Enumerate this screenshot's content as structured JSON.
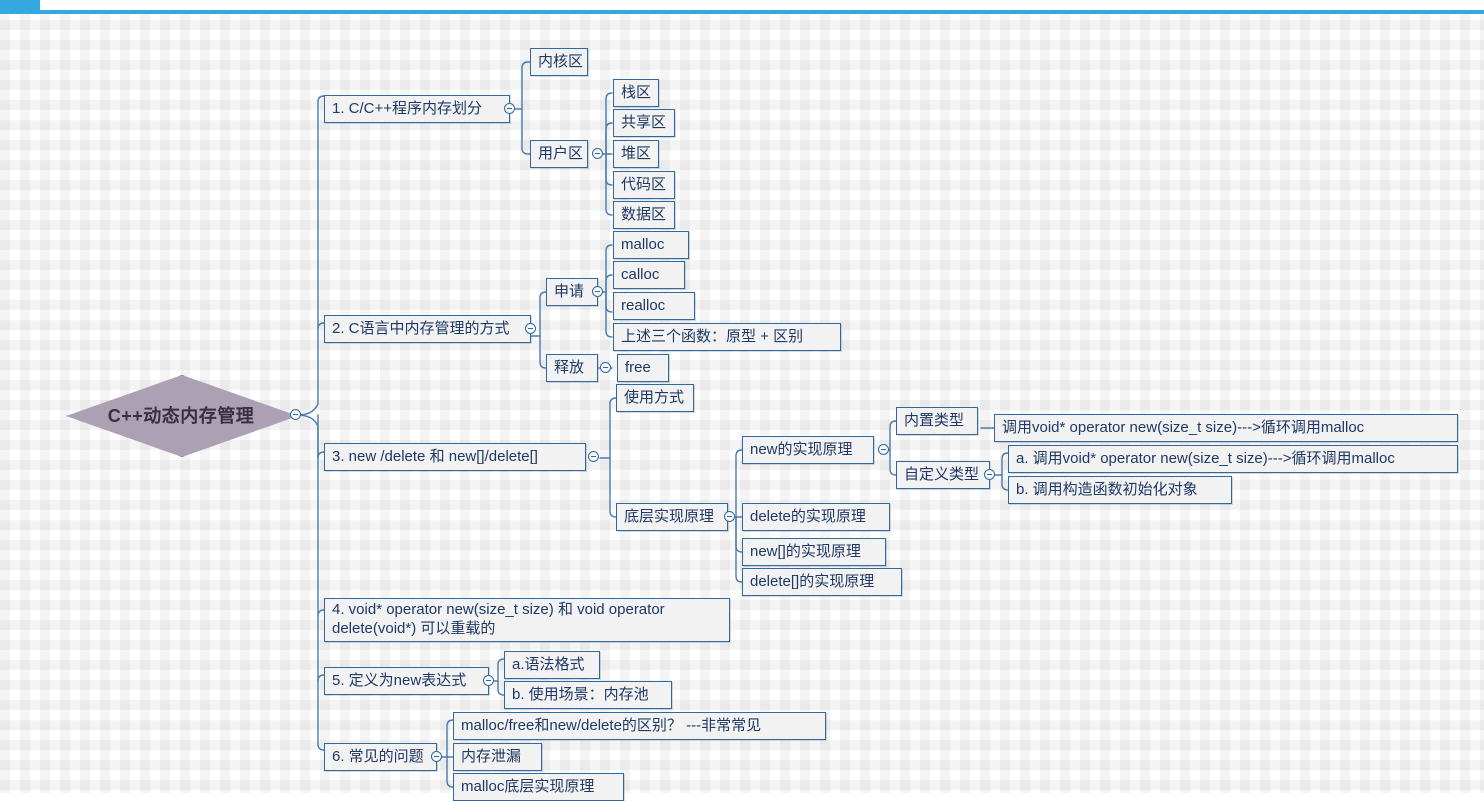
{
  "window": {
    "accent_color": "#35a8dd",
    "tab_label": ""
  },
  "theme": {
    "node_border": "#31699c",
    "node_fill": "#f2f2f2",
    "node_text": "#1f3864",
    "root_fill": "#aca0b4",
    "root_border": "#7d7390",
    "root_text": "#3b2e3f",
    "link_color": "#4a7ab0"
  },
  "diagram": {
    "type": "mindmap",
    "root": "C++动态内存管理",
    "nodes": {
      "root": "C++动态内存管理",
      "b1": "1. C/C++程序内存划分",
      "b1_1": "内核区",
      "b1_2": "用户区",
      "b1_2_1": "栈区",
      "b1_2_2": "共享区",
      "b1_2_3": "堆区",
      "b1_2_4": "代码区",
      "b1_2_5": "数据区",
      "b2": "2. C语言中内存管理的方式",
      "b2_1": "申请",
      "b2_1_1": "malloc",
      "b2_1_2": "calloc",
      "b2_1_3": "realloc",
      "b2_1_4": "上述三个函数：原型 + 区别",
      "b2_2": "释放",
      "b2_2_1": "free",
      "b3": "3. new /delete 和 new[]/delete[]",
      "b3_1": "使用方式",
      "b3_2": "底层实现原理",
      "b3_2_1": "new的实现原理",
      "b3_2_1_1": "内置类型",
      "b3_2_1_1_1": "调用void* operator new(size_t size)--->循环调用malloc",
      "b3_2_1_2": "自定义类型",
      "b3_2_1_2_1": "a. 调用void* operator new(size_t size)--->循环调用malloc",
      "b3_2_1_2_2": "b. 调用构造函数初始化对象",
      "b3_2_2": "delete的实现原理",
      "b3_2_3": "new[]的实现原理",
      "b3_2_4": "delete[]的实现原理",
      "b4": "4. void* operator new(size_t size) 和 void  operator delete(void*) 可以重载的",
      "b5": "5. 定义为new表达式",
      "b5_1": "a.语法格式",
      "b5_2": "b. 使用场景：内存池",
      "b6": "6. 常见的问题",
      "b6_1": "malloc/free和new/delete的区别？   ---非常常见",
      "b6_2": "内存泄漏",
      "b6_3": "malloc底层实现原理"
    }
  }
}
